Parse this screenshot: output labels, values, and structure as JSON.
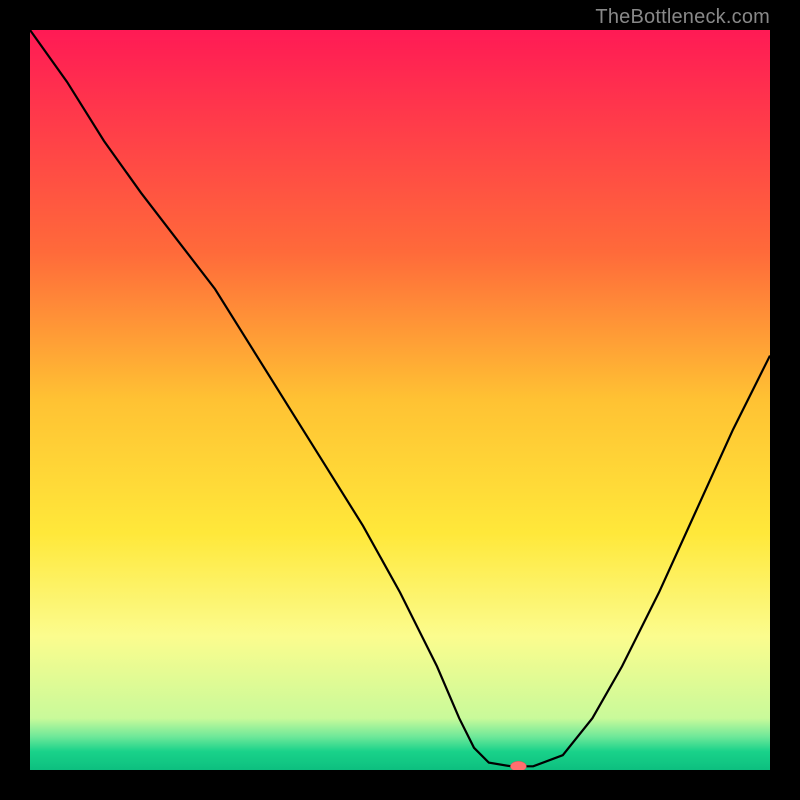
{
  "watermark": "TheBottleneck.com",
  "chart_data": {
    "type": "line",
    "title": "",
    "xlabel": "",
    "ylabel": "",
    "xlim": [
      0,
      100
    ],
    "ylim": [
      0,
      100
    ],
    "background_gradient": {
      "stops": [
        {
          "offset": 0,
          "color": "#ff1a55"
        },
        {
          "offset": 0.3,
          "color": "#ff6a3a"
        },
        {
          "offset": 0.5,
          "color": "#ffc233"
        },
        {
          "offset": 0.68,
          "color": "#ffe83a"
        },
        {
          "offset": 0.82,
          "color": "#fbfc8e"
        },
        {
          "offset": 0.93,
          "color": "#c9fa9a"
        },
        {
          "offset": 0.955,
          "color": "#6ee899"
        },
        {
          "offset": 0.975,
          "color": "#19d28a"
        },
        {
          "offset": 1.0,
          "color": "#0dbf7f"
        }
      ]
    },
    "series": [
      {
        "name": "bottleneck-curve",
        "color": "#000000",
        "x": [
          0,
          5,
          10,
          15,
          20,
          25,
          30,
          35,
          40,
          45,
          50,
          55,
          58,
          60,
          62,
          65,
          68,
          72,
          76,
          80,
          85,
          90,
          95,
          100
        ],
        "y": [
          100,
          93,
          85,
          78,
          71.5,
          65,
          57,
          49,
          41,
          33,
          24,
          14,
          7,
          3,
          1,
          0.5,
          0.5,
          2,
          7,
          14,
          24,
          35,
          46,
          56
        ]
      }
    ],
    "marker": {
      "name": "optimal-point",
      "x": 66,
      "y": 0.5,
      "color": "#ff6f6f",
      "rx": 8,
      "ry": 5
    }
  }
}
